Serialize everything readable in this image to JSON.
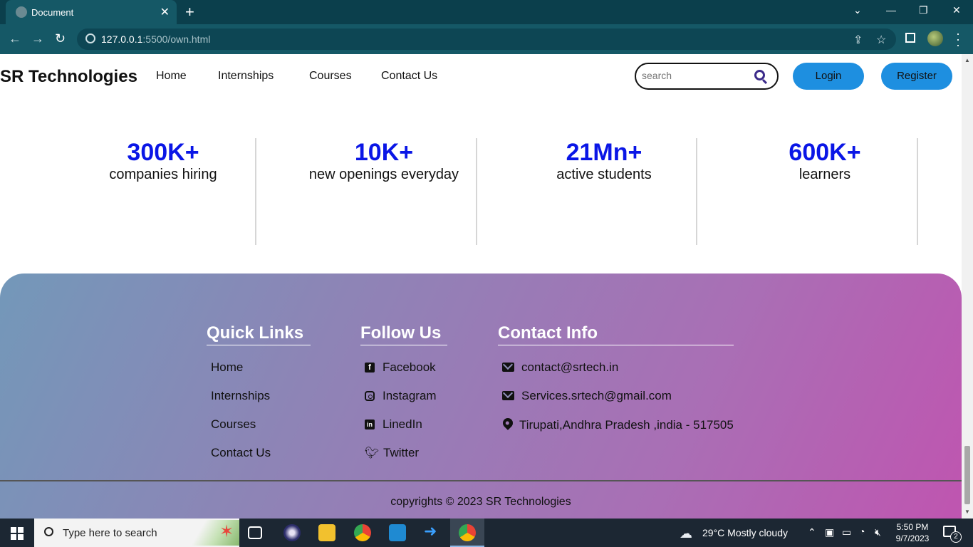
{
  "browser": {
    "tab_title": "Document",
    "url_host": "127.0.0.1",
    "url_rest": ":5500/own.html"
  },
  "site": {
    "brand": "SR Technologies",
    "nav": [
      "Home",
      "Internships",
      "Courses",
      "Contact Us"
    ],
    "search_placeholder": "search",
    "login_label": "Login",
    "register_label": "Register"
  },
  "stats": [
    {
      "value": "300K+",
      "label": "companies hiring"
    },
    {
      "value": "10K+",
      "label": "new openings everyday"
    },
    {
      "value": "21Mn+",
      "label": "active students"
    },
    {
      "value": "600K+",
      "label": "learners"
    }
  ],
  "footer": {
    "quick_links_title": "Quick Links",
    "quick_links": [
      "Home",
      "Internships",
      "Courses",
      "Contact Us"
    ],
    "follow_title": "Follow Us",
    "follow": [
      "Facebook",
      "Instagram",
      "LinedIn",
      "Twitter"
    ],
    "contact_title": "Contact Info",
    "contact": [
      "contact@srtech.in",
      "Services.srtech@gmail.com",
      "Tirupati,Andhra Pradesh ,india - 517505"
    ],
    "copyright": "copyrights ©   2023 SR Technologies"
  },
  "taskbar": {
    "search_placeholder": "Type here to search",
    "weather": "29°C  Mostly cloudy",
    "time": "5:50 PM",
    "date": "9/7/2023",
    "notifications": "2"
  },
  "colors": {
    "stat_number": "#0a16e6",
    "button": "#1e8fe0",
    "footer_gradient_start": "#7398b9",
    "footer_gradient_end": "#bf55b0",
    "chrome_dark": "#0b3f4c"
  }
}
